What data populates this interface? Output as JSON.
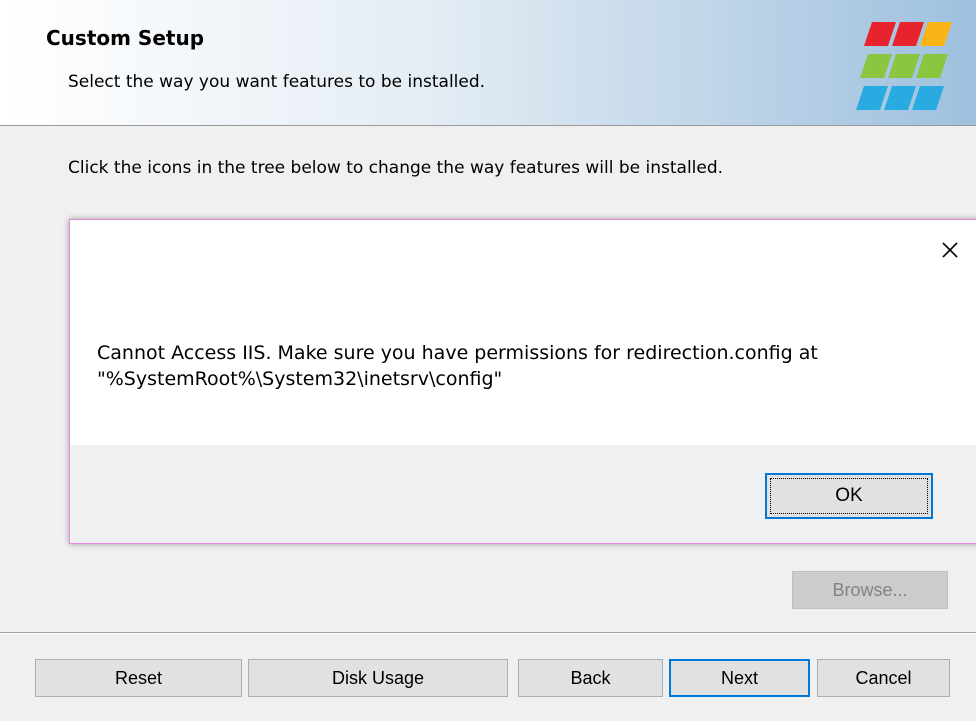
{
  "header": {
    "title": "Custom Setup",
    "subtitle": "Select the way you want features to be installed."
  },
  "instruction": "Click the icons in the tree below to change the way features will be installed.",
  "dialog": {
    "message_line1": "Cannot Access IIS. Make sure you have permissions for redirection.config at",
    "message_line2": "\"%SystemRoot%\\System32\\inetsrv\\config\"",
    "ok_label": "OK"
  },
  "buttons": {
    "browse": "Browse...",
    "reset": "Reset",
    "disk_usage": "Disk Usage",
    "back": "Back",
    "next": "Next",
    "cancel": "Cancel"
  },
  "colors": {
    "logo_red": "#e8232e",
    "logo_green": "#8cc63f",
    "logo_yellow": "#fbb415",
    "logo_blue": "#29abe2",
    "focus_blue": "#0078d7"
  }
}
